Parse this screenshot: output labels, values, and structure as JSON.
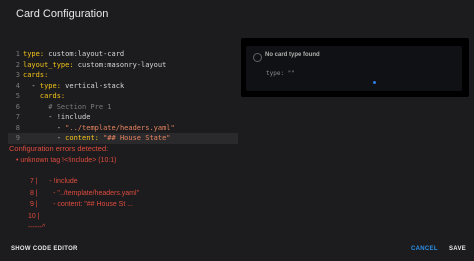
{
  "dialog": {
    "title": "Card Configuration"
  },
  "editor": {
    "lines": [
      {
        "num": "1",
        "parts": [
          [
            "k",
            "type:"
          ],
          [
            "p",
            " custom:layout-card"
          ]
        ]
      },
      {
        "num": "2",
        "parts": [
          [
            "k",
            "layout_type:"
          ],
          [
            "p",
            " custom:masonry-layout"
          ]
        ]
      },
      {
        "num": "3",
        "parts": [
          [
            "k",
            "cards:"
          ]
        ]
      },
      {
        "num": "4",
        "parts": [
          [
            "p",
            "  - "
          ],
          [
            "k",
            "type:"
          ],
          [
            "p",
            " vertical-stack"
          ]
        ]
      },
      {
        "num": "5",
        "parts": [
          [
            "p",
            "    "
          ],
          [
            "k",
            "cards:"
          ]
        ]
      },
      {
        "num": "6",
        "parts": [
          [
            "c",
            "      # Section Pre 1"
          ]
        ]
      },
      {
        "num": "7",
        "parts": [
          [
            "p",
            "      - !include"
          ]
        ]
      },
      {
        "num": "8",
        "parts": [
          [
            "p",
            "        - "
          ],
          [
            "s",
            "\"../template/headers.yaml\""
          ]
        ]
      },
      {
        "num": "9",
        "parts": [
          [
            "p",
            "        - "
          ],
          [
            "k",
            "content:"
          ],
          [
            "p",
            " "
          ],
          [
            "s",
            "\"## House State\""
          ]
        ]
      }
    ]
  },
  "preview": {
    "title": "No card type found",
    "type_line": "type: \"\""
  },
  "errors": {
    "title": "Configuration errors detected:",
    "message": "• unknown tag !<!include> (10:1)",
    "trace": [
      " 7 |      - !include",
      " 8 |        - \"../template/headers.yaml\"",
      " 9 |        - content: \"## House St ...",
      "10 |",
      "------^"
    ]
  },
  "footer": {
    "show_code_editor": "SHOW CODE EDITOR",
    "cancel": "CANCEL",
    "save": "SAVE"
  },
  "colors": {
    "accent": "#2b8fe9",
    "error": "#e04b3e",
    "key": "#f5c518",
    "string": "#e8845f"
  }
}
